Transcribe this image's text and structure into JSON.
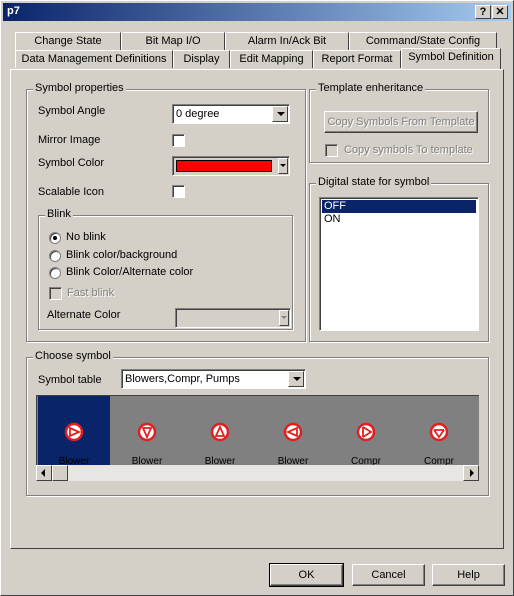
{
  "window": {
    "title": "p7",
    "help_glyph": "?",
    "close_glyph": "✕"
  },
  "tabs_back": [
    "Change State",
    "Bit Map I/O",
    "Alarm In/Ack Bit",
    "Command/State Config"
  ],
  "tabs_front": [
    "Data Management Definitions",
    "Display",
    "Edit Mapping",
    "Report Format",
    "Symbol Definition"
  ],
  "active_tab": "Symbol Definition",
  "symbol_properties": {
    "legend": "Symbol properties",
    "angle_label": "Symbol Angle",
    "angle_value": "0 degree",
    "mirror_label": "Mirror Image",
    "mirror_checked": false,
    "color_label": "Symbol Color",
    "color_value": "#ff0000",
    "scalable_label": "Scalable Icon",
    "scalable_checked": false
  },
  "blink": {
    "legend": "Blink",
    "options": [
      "No blink",
      "Blink color/background",
      "Blink Color/Alternate color"
    ],
    "selected_index": 0,
    "fast_blink_label": "Fast blink",
    "alternate_color_label": "Alternate Color"
  },
  "template": {
    "legend": "Template enheritance",
    "copy_from_label": "Copy Symbols From Template",
    "copy_to_label": "Copy symbols To template"
  },
  "digital_state": {
    "legend": "Digital state for symbol",
    "items": [
      "OFF",
      "ON"
    ],
    "selected_index": 0
  },
  "choose_symbol": {
    "legend": "Choose symbol",
    "table_label": "Symbol table",
    "table_value": "Blowers,Compr, Pumps",
    "symbols": [
      {
        "caption": "Blower",
        "icon": "blower-right-icon"
      },
      {
        "caption": "Blower",
        "icon": "blower-down-icon"
      },
      {
        "caption": "Blower",
        "icon": "blower-up-icon"
      },
      {
        "caption": "Blower",
        "icon": "blower-left-icon"
      },
      {
        "caption": "Compr",
        "icon": "compressor-right-icon"
      },
      {
        "caption": "Compr",
        "icon": "compressor-down-icon"
      }
    ],
    "selected_index": 0
  },
  "buttons": {
    "ok": "OK",
    "cancel": "Cancel",
    "help": "Help"
  },
  "colors": {
    "selection": "#0a246a",
    "symbol_red": "#e02020"
  }
}
